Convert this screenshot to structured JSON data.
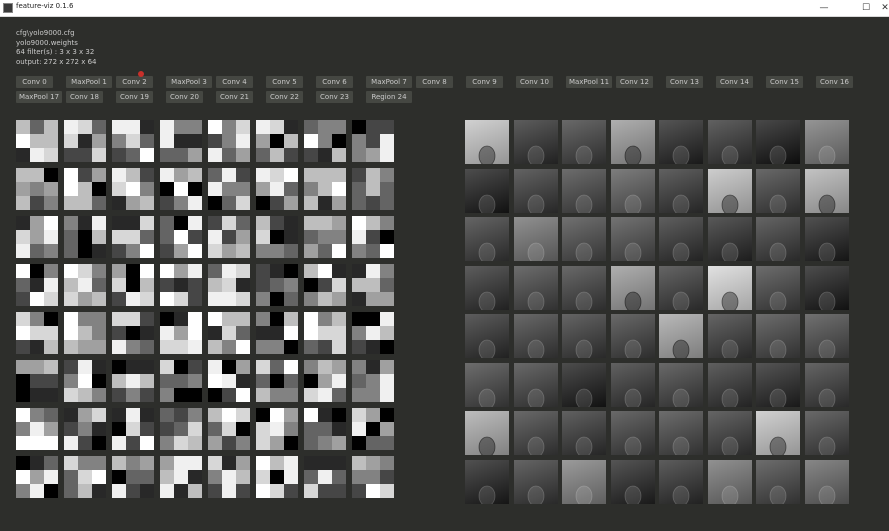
{
  "window": {
    "title": "feature-viz 0.1.6",
    "controls": {
      "minimize": "—",
      "maximize": "☐",
      "close": "✕"
    }
  },
  "info": {
    "config": "cfg\\yolo9000.cfg",
    "weights": "yolo9000.weights",
    "filters": "64 filter(s) : 3 x 3 x 32",
    "output": "output: 272 x 272 x 64"
  },
  "layers": [
    "Conv 0",
    "MaxPool 1",
    "Conv 2",
    "MaxPool 3",
    "Conv 4",
    "Conv 5",
    "Conv 6",
    "MaxPool 7",
    "Conv 8",
    "Conv 9",
    "Conv 10",
    "MaxPool 11",
    "Conv 12",
    "Conv 13",
    "Conv 14",
    "Conv 15",
    "Conv 16",
    "MaxPool 17",
    "Conv 18",
    "Conv 19",
    "Conv 20",
    "Conv 21",
    "Conv 22",
    "Conv 23",
    "Region 24"
  ],
  "filters_grid": {
    "rows": 8,
    "cols": 8,
    "cells_per_filter": 3
  },
  "feature_maps": {
    "rows": 8,
    "cols": 8,
    "levels": [
      [
        0.72,
        0.14,
        0.2,
        0.55,
        0.1,
        0.16,
        0.04,
        0.42
      ],
      [
        0.06,
        0.17,
        0.22,
        0.3,
        0.16,
        0.7,
        0.2,
        0.65
      ],
      [
        0.18,
        0.4,
        0.24,
        0.25,
        0.15,
        0.12,
        0.18,
        0.08
      ],
      [
        0.14,
        0.22,
        0.2,
        0.55,
        0.18,
        0.8,
        0.22,
        0.06
      ],
      [
        0.14,
        0.2,
        0.18,
        0.2,
        0.6,
        0.18,
        0.22,
        0.24
      ],
      [
        0.22,
        0.2,
        0.06,
        0.16,
        0.2,
        0.15,
        0.1,
        0.18
      ],
      [
        0.62,
        0.2,
        0.16,
        0.2,
        0.22,
        0.18,
        0.72,
        0.2
      ],
      [
        0.08,
        0.18,
        0.45,
        0.1,
        0.14,
        0.4,
        0.22,
        0.35
      ]
    ]
  }
}
